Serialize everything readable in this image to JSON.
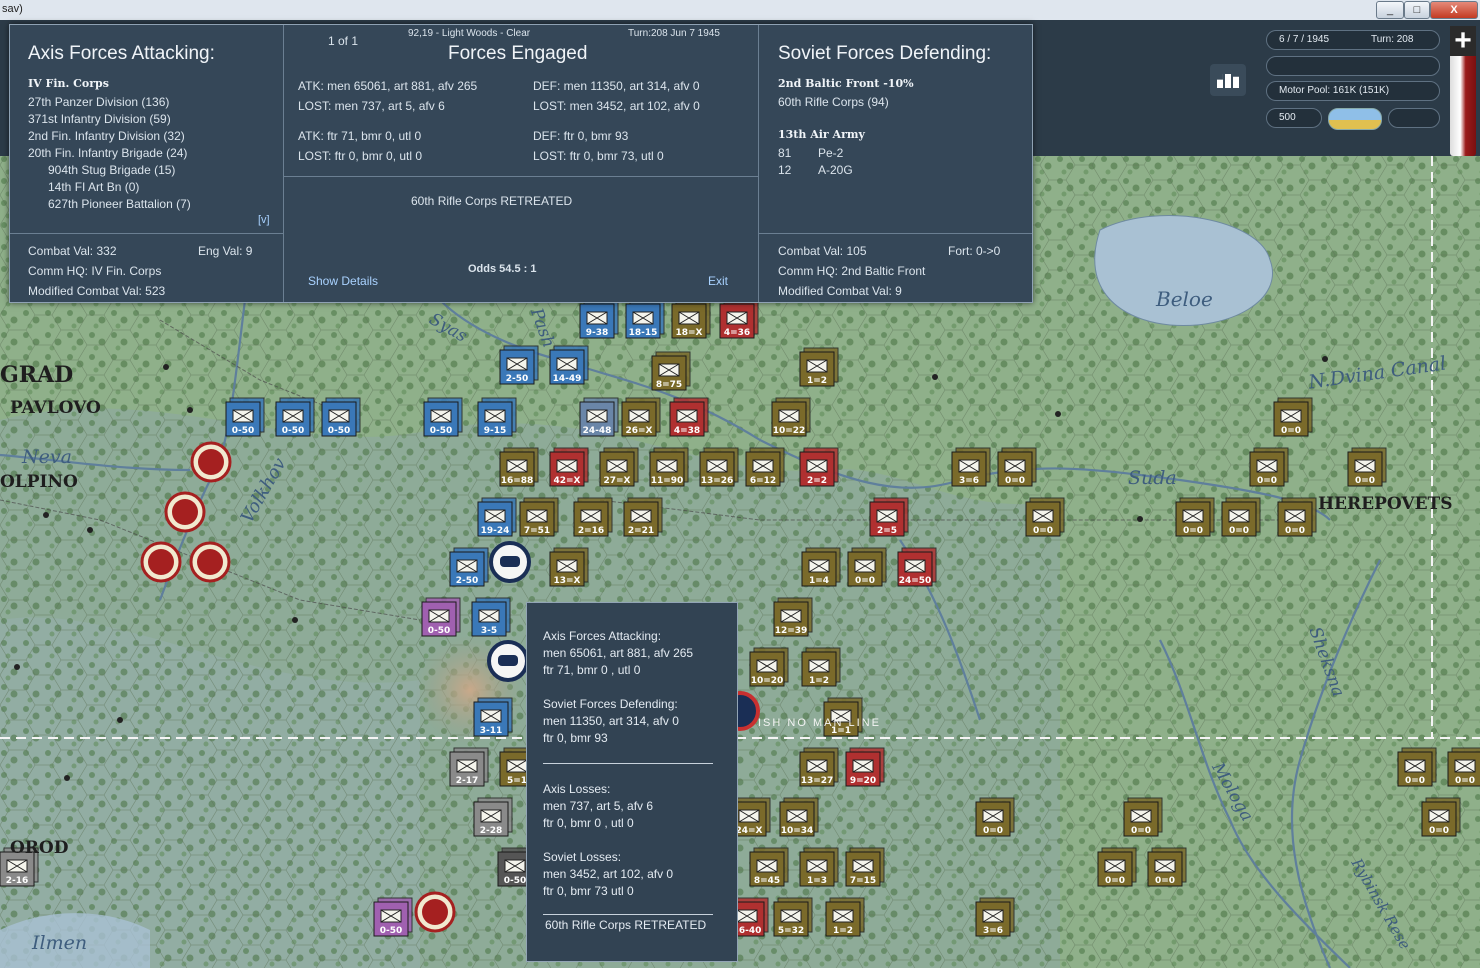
{
  "window": {
    "title": "sav)",
    "buttons": [
      "_",
      "□",
      "X"
    ]
  },
  "combat": {
    "page": "1 of 1",
    "hex_info": "92,19 - Light Woods - Clear",
    "turn_info": "Turn:208  Jun 7 1945",
    "center_title": "Forces Engaged",
    "atk_ground": "ATK: men 65061, art 881, afv 265",
    "atk_ground_lost": "LOST: men 737, art 5, afv 6",
    "def_ground": "DEF: men 11350, art 314, afv 0",
    "def_ground_lost": "LOST: men 3452, art 102, afv 0",
    "atk_air": "ATK: ftr 71, bmr 0, utl 0",
    "atk_air_lost": "LOST: ftr 0, bmr 0, utl 0",
    "def_air": "DEF: ftr 0, bmr 93",
    "def_air_lost": "LOST: ftr 0, bmr 73, utl 0",
    "result": "60th Rifle Corps RETREATED",
    "show_details": "Show Details",
    "odds": "Odds 54.5 : 1",
    "exit": "Exit",
    "attacker": {
      "title": "Axis Forces Attacking:",
      "corps": "IV Fin. Corps",
      "units": [
        "27th Panzer Division (136)",
        "371st Infantry Division (59)",
        "2nd Fin. Infantry Division (32)",
        "20th Fin. Infantry Brigade (24)"
      ],
      "subunits": [
        "904th Stug Brigade (15)",
        "14th FI Art Bn (0)",
        "627th Pioneer Battalion (7)"
      ],
      "toggle": "[v]",
      "combat_val": "Combat Val: 332",
      "eng_val": "Eng Val: 9",
      "comm_hq": "Comm HQ: IV Fin. Corps",
      "mod_val": "Modified Combat Val: 523"
    },
    "defender": {
      "title": "Soviet Forces Defending:",
      "front": "2nd Baltic Front  -10%",
      "units": [
        "60th Rifle Corps (94)"
      ],
      "air_army": "13th Air Army",
      "air": [
        {
          "count": "81",
          "type": "Pe-2"
        },
        {
          "count": "12",
          "type": "A-20G"
        }
      ],
      "combat_val": "Combat Val: 105",
      "fort": "Fort: 0->0",
      "comm_hq": "Comm HQ: 2nd Baltic Front",
      "mod_val": "Modified Combat Val: 9"
    }
  },
  "hud": {
    "date": "6 / 7 / 1945",
    "turn": "Turn: 208",
    "motor_pool": "Motor Pool:  161K (151K)",
    "value": "500",
    "zoom_label": "+"
  },
  "tooltip": {
    "attack_title": "Axis Forces Attacking:",
    "attack_ground": "men  65061,  art  881,  afv  265",
    "attack_air": "ftr  71,  bmr  0 ,  utl  0",
    "defend_title": "Soviet Forces Defending:",
    "defend_ground": "men  11350,  art  314,  afv  0",
    "defend_air": "ftr  0,  bmr  93",
    "axis_loss_title": "Axis Losses:",
    "axis_loss_ground": "men  737,  art  5,  afv  6",
    "axis_loss_air": "ftr  0,  bmr  0 ,  utl  0",
    "soviet_loss_title": "Soviet Losses:",
    "soviet_loss_ground": "men  3452,  art  102,  afv  0",
    "soviet_loss_air": " ftr  0,  bmr  73   utl  0",
    "result": "60th Rifle Corps RETREATED"
  },
  "map_labels": {
    "grad": "GRAD",
    "pavlovo": "PAVLOVO",
    "neva": "Neva",
    "kolpino": "OLPINO",
    "volkhov": "Volkhov",
    "syas": "Syas",
    "pash": "Pash",
    "beloe": "Beloe",
    "ndvina": "N.Dvina Canal",
    "suda": "Suda",
    "cherepovets": "HEREPOVETS",
    "sheksna": "Sheksna",
    "mologa": "Mologa",
    "rybinsk": "Rybinsk Rese",
    "novgorod": "OROD",
    "ilmen": "Ilmen",
    "nomansland": "ISH NO MAN LINE"
  },
  "counters": [
    {
      "l": "9-38",
      "c": "#3a78b8"
    },
    {
      "l": "18-15",
      "c": "#3a78b8"
    },
    {
      "l": "18=X",
      "c": "#7a6a2a"
    },
    {
      "l": "4=36",
      "c": "#b03030"
    },
    {
      "l": "2-50",
      "c": "#3a78b8"
    },
    {
      "l": "14-49",
      "c": "#3a78b8"
    },
    {
      "l": "8=75",
      "c": "#7a6a2a"
    },
    {
      "l": "1=2",
      "c": "#7a6a2a"
    },
    {
      "l": "0-50",
      "c": "#3a78b8"
    },
    {
      "l": "0-50",
      "c": "#3a78b8"
    },
    {
      "l": "0-50",
      "c": "#3a78b8"
    },
    {
      "l": "0-50",
      "c": "#3a78b8"
    },
    {
      "l": "9-15",
      "c": "#3a78b8"
    },
    {
      "l": "24-48",
      "c": "#6a86a8"
    },
    {
      "l": "26=X",
      "c": "#7a6a2a"
    },
    {
      "l": "4=38",
      "c": "#b03030"
    },
    {
      "l": "10=22",
      "c": "#7a6a2a"
    },
    {
      "l": "0=0",
      "c": "#7a6a2a"
    },
    {
      "l": "16=88",
      "c": "#7a6a2a"
    },
    {
      "l": "42=X",
      "c": "#b03030"
    },
    {
      "l": "27=X",
      "c": "#7a6a2a"
    },
    {
      "l": "11=90",
      "c": "#7a6a2a"
    },
    {
      "l": "13=26",
      "c": "#7a6a2a"
    },
    {
      "l": "6=12",
      "c": "#7a6a2a"
    },
    {
      "l": "2=2",
      "c": "#b03030"
    },
    {
      "l": "3=6",
      "c": "#7a6a2a"
    },
    {
      "l": "0=0",
      "c": "#7a6a2a"
    },
    {
      "l": "0=0",
      "c": "#7a6a2a"
    },
    {
      "l": "0=0",
      "c": "#7a6a2a"
    },
    {
      "l": "19-24",
      "c": "#3a78b8"
    },
    {
      "l": "7=51",
      "c": "#7a6a2a"
    },
    {
      "l": "2=16",
      "c": "#7a6a2a"
    },
    {
      "l": "2=21",
      "c": "#7a6a2a"
    },
    {
      "l": "2=5",
      "c": "#b03030"
    },
    {
      "l": "0=0",
      "c": "#7a6a2a"
    },
    {
      "l": "0=0",
      "c": "#7a6a2a"
    },
    {
      "l": "0=0",
      "c": "#7a6a2a"
    },
    {
      "l": "0=0",
      "c": "#7a6a2a"
    },
    {
      "l": "2-50",
      "c": "#3a78b8"
    },
    {
      "l": "13=X",
      "c": "#7a6a2a"
    },
    {
      "l": "1=4",
      "c": "#7a6a2a"
    },
    {
      "l": "0=0",
      "c": "#7a6a2a"
    },
    {
      "l": "24=50",
      "c": "#b03030"
    },
    {
      "l": "0-50",
      "c": "#a060b0"
    },
    {
      "l": "3-5",
      "c": "#3a78b8"
    },
    {
      "l": "12=39",
      "c": "#7a6a2a"
    },
    {
      "l": "10=20",
      "c": "#7a6a2a"
    },
    {
      "l": "1=2",
      "c": "#7a6a2a"
    },
    {
      "l": "1=1",
      "c": "#7a6a2a"
    },
    {
      "l": "3-11",
      "c": "#3a78b8"
    },
    {
      "l": "2-17",
      "c": "#8a8a8a"
    },
    {
      "l": "5=1",
      "c": "#7a6a2a"
    },
    {
      "l": "13=27",
      "c": "#7a6a2a"
    },
    {
      "l": "9=20",
      "c": "#b03030"
    },
    {
      "l": "0=0",
      "c": "#7a6a2a"
    },
    {
      "l": "0=0",
      "c": "#7a6a2a"
    },
    {
      "l": "2-28",
      "c": "#8a8a8a"
    },
    {
      "l": "24=X",
      "c": "#7a6a2a"
    },
    {
      "l": "10=34",
      "c": "#7a6a2a"
    },
    {
      "l": "0=0",
      "c": "#7a6a2a"
    },
    {
      "l": "0=0",
      "c": "#7a6a2a"
    },
    {
      "l": "0=0",
      "c": "#7a6a2a"
    },
    {
      "l": "0-50",
      "c": "#555"
    },
    {
      "l": "8=45",
      "c": "#7a6a2a"
    },
    {
      "l": "1=3",
      "c": "#7a6a2a"
    },
    {
      "l": "7=15",
      "c": "#7a6a2a"
    },
    {
      "l": "0=0",
      "c": "#7a6a2a"
    },
    {
      "l": "0=0",
      "c": "#7a6a2a"
    },
    {
      "l": "2-16",
      "c": "#8a8a8a"
    },
    {
      "l": "0-50",
      "c": "#a060b0"
    },
    {
      "l": "36-40",
      "c": "#b03030"
    },
    {
      "l": "5=32",
      "c": "#7a6a2a"
    },
    {
      "l": "1=2",
      "c": "#7a6a2a"
    },
    {
      "l": "3=6",
      "c": "#7a6a2a"
    }
  ]
}
